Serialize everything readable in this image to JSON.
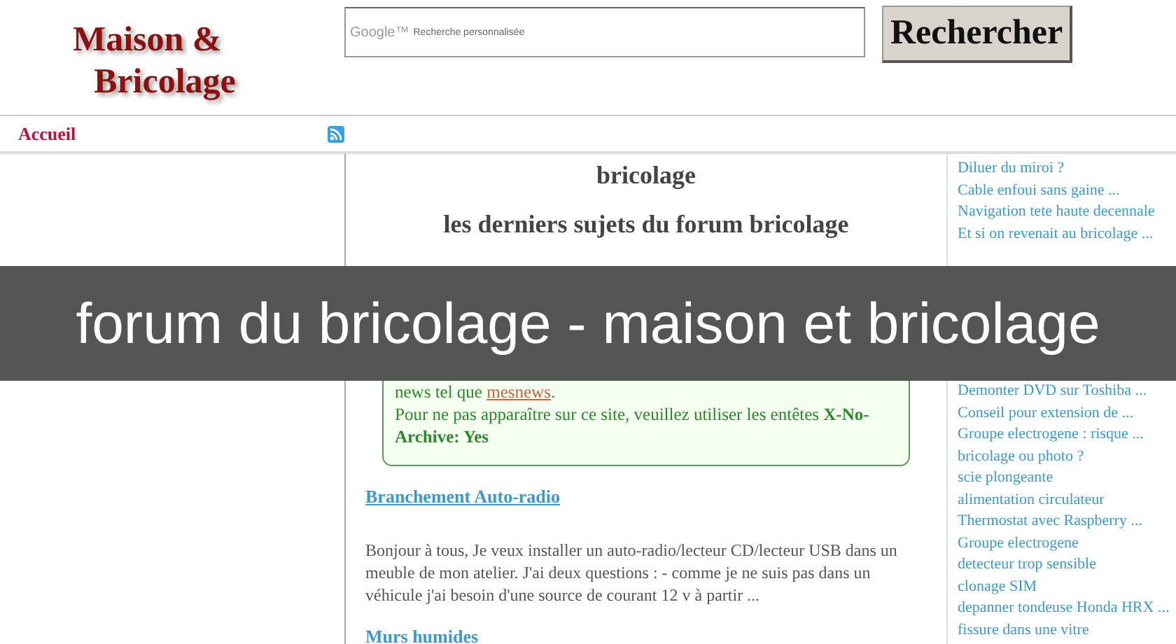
{
  "logo": {
    "line_1": "Maison &",
    "line_2": "Bricolage"
  },
  "search": {
    "brand": "Google™",
    "placeholder": "Recherche personnalisée",
    "button": "Rechercher"
  },
  "nav": {
    "items": [
      {
        "label": "Accueil"
      }
    ]
  },
  "main": {
    "heading": "bricolage",
    "subheading": "les derniers sujets du forum bricolage",
    "notice": [
      {
        "text": "news tel que ",
        "link": "mesnews",
        "after": "."
      },
      {
        "text": "Pour ne pas apparaître sur ce site, veuillez utiliser les entêtes **X-No-Archive: Yes**"
      }
    ],
    "topics": [
      {
        "title": "Branchement Auto-radio",
        "excerpt": "Bonjour à tous, Je veux installer un auto-radio/lecteur CD/lecteur USB dans un meuble de mon atelier. J'ai deux questions : - comme je ne suis pas dans un véhicule j'ai besoin d'une source de courant 12 v à partir ..."
      },
      {
        "title": "Murs humides"
      }
    ]
  },
  "sidebar": {
    "items_above": [
      "Diluer du miroi ?",
      "Cable enfoui sans gaine ...",
      "Navigation tete haute decennale",
      "Et si on revenait au bricolage ..."
    ],
    "items_below": [
      "Demonter DVD sur Toshiba ...",
      "Conseil pour extension de ...",
      "Groupe electrogene : risque ...",
      "bricolage ou photo ?",
      "scie plongeante",
      "alimentation circulateur",
      "Thermostat avec Raspberry ...",
      "Groupe electrogene",
      "detecteur trop sensible",
      "clonage SIM",
      "depanner tondeuse Honda HRX ...",
      "fissure dans une vitre"
    ]
  },
  "overlay_caption": "forum du bricolage - maison et bricolage"
}
